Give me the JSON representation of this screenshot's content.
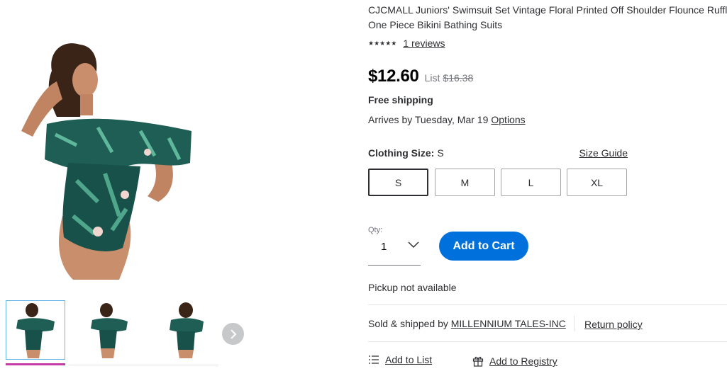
{
  "product": {
    "title_line1": "CJCMALL Juniors' Swimsuit Set Vintage Floral Printed Off Shoulder Flounce Ruffled",
    "title_line2": "One Piece Bikini Bathing Suits",
    "stars": "★★★★★",
    "rating": 5,
    "reviews": "1 reviews",
    "price": "$12.60",
    "list_label": "List",
    "list_price": "$16.38"
  },
  "shipping": {
    "free": "Free shipping",
    "arrives": "Arrives by Tuesday, Mar 19",
    "options": "Options"
  },
  "size": {
    "label": "Clothing Size:",
    "selected": "S",
    "guide": "Size Guide",
    "options": [
      "S",
      "M",
      "L",
      "XL"
    ]
  },
  "qty": {
    "label": "Qty:",
    "value": "1"
  },
  "actions": {
    "add_to_cart": "Add to Cart",
    "add_to_list": "Add to List",
    "add_to_registry": "Add to Registry"
  },
  "fulfillment": {
    "pickup": "Pickup not available",
    "sold_prefix": "Sold & shipped by",
    "seller": "MILLENNIUM TALES-INC",
    "return_policy": "Return policy"
  },
  "colors": {
    "accent_blue": "#0071dc",
    "thumb_underline": "#c33ba5",
    "swimsuit_green": "#1f6a5a"
  }
}
